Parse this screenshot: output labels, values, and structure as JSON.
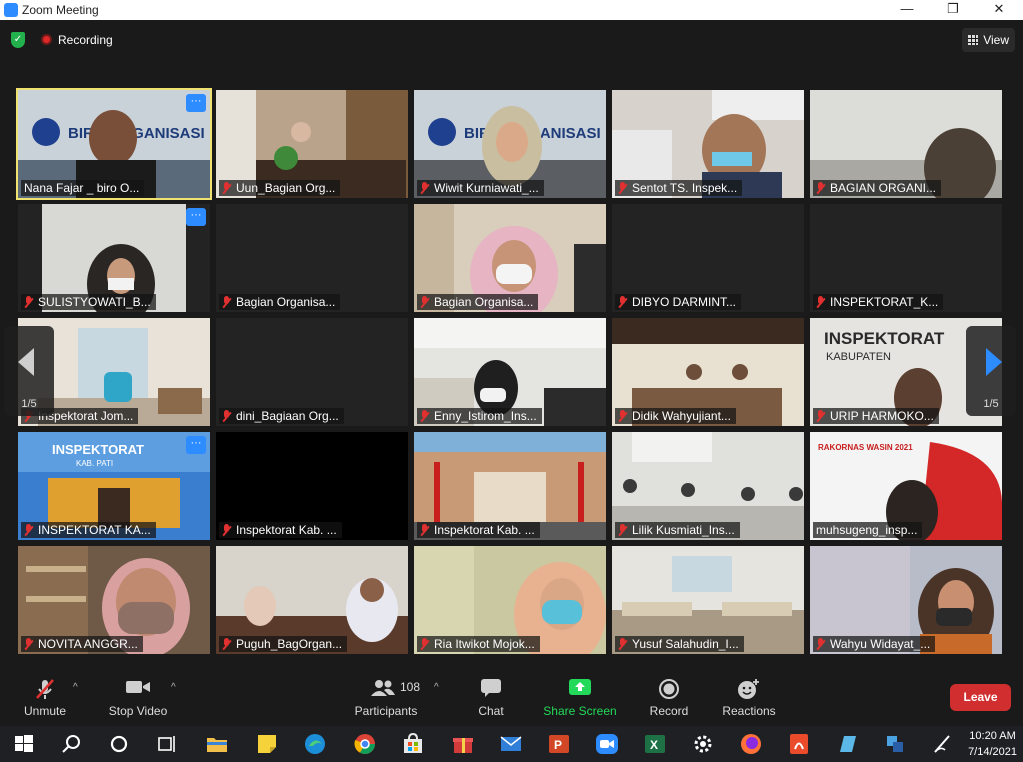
{
  "window": {
    "title": "Zoom Meeting",
    "minimize": "—",
    "restore": "❐",
    "close": "✕"
  },
  "status": {
    "recording_label": "Recording",
    "view_label": "View"
  },
  "pager": {
    "left_page": "1/5",
    "right_page": "1/5"
  },
  "participants": [
    {
      "name": "Nana Fajar _ biro O...",
      "muted": false,
      "active": true,
      "more": true
    },
    {
      "name": "Uun_Bagian Org...",
      "muted": true
    },
    {
      "name": "Wiwit Kurniawati_...",
      "muted": true
    },
    {
      "name": "Sentot TS. Inspek...",
      "muted": true
    },
    {
      "name": "BAGIAN ORGANI...",
      "muted": true
    },
    {
      "name": "SULISTYOWATI_B...",
      "muted": true,
      "more": true
    },
    {
      "name": "Bagian Organisa...",
      "muted": true
    },
    {
      "name": "Bagian Organisa...",
      "muted": true
    },
    {
      "name": "DIBYO DARMINT...",
      "muted": true
    },
    {
      "name": "INSPEKTORAT_K...",
      "muted": true
    },
    {
      "name": "Inspektorat Jom...",
      "muted": true
    },
    {
      "name": "dini_Bagiaan Org...",
      "muted": true
    },
    {
      "name": "Enny_Istirom_Ins...",
      "muted": true
    },
    {
      "name": "Didik Wahyujiant...",
      "muted": true
    },
    {
      "name": "URIP HARMOKO...",
      "muted": true
    },
    {
      "name": "INSPEKTORAT KA...",
      "muted": true,
      "more": true
    },
    {
      "name": "Inspektorat Kab. ...",
      "muted": true
    },
    {
      "name": "Inspektorat Kab. ...",
      "muted": true
    },
    {
      "name": "Lilik Kusmiati_Ins...",
      "muted": true
    },
    {
      "name": "muhsugeng_insp...",
      "muted": false
    },
    {
      "name": "NOVITA ANGGR...",
      "muted": true
    },
    {
      "name": "Puguh_BagOrgan...",
      "muted": true
    },
    {
      "name": "Ria Itwikot Mojok...",
      "muted": true
    },
    {
      "name": "Yusuf Salahudin_I...",
      "muted": true
    },
    {
      "name": "Wahyu Widayat_...",
      "muted": true
    }
  ],
  "tile_text": {
    "biro_banner": "BIRO ORGANISASI",
    "insp_sign1": "INSPEKTORAT",
    "insp_sign2": "KABUPATEN",
    "insp_sign3": "INSPEKTORAT",
    "insp_sign4": "KAB. PATI",
    "rakornas": "RAKORNAS WASIN 2021"
  },
  "toolbar": {
    "unmute": "Unmute",
    "stop_video": "Stop Video",
    "participants_label": "Participants",
    "participants_count": "108",
    "chat": "Chat",
    "share_screen": "Share Screen",
    "record": "Record",
    "reactions": "Reactions",
    "leave": "Leave"
  },
  "colors": {
    "share_green": "#23d959",
    "zoom_blue": "#2d8cff",
    "leave_red": "#d12f2f",
    "active_yellow": "#f0e270"
  },
  "taskbar": {
    "icons": [
      "windows-start-icon",
      "search-icon",
      "cortana-icon",
      "task-view-icon",
      "file-explorer-icon",
      "sticky-notes-icon",
      "edge-icon",
      "chrome-icon",
      "store-icon",
      "gift-icon",
      "mail-icon",
      "powerpoint-icon",
      "zoom-icon",
      "excel-icon",
      "settings-icon",
      "firefox-icon",
      "pdf-icon",
      "notes-icon",
      "network-icon",
      "pen-icon"
    ],
    "time": "10:20 AM",
    "date": "7/14/2021"
  }
}
